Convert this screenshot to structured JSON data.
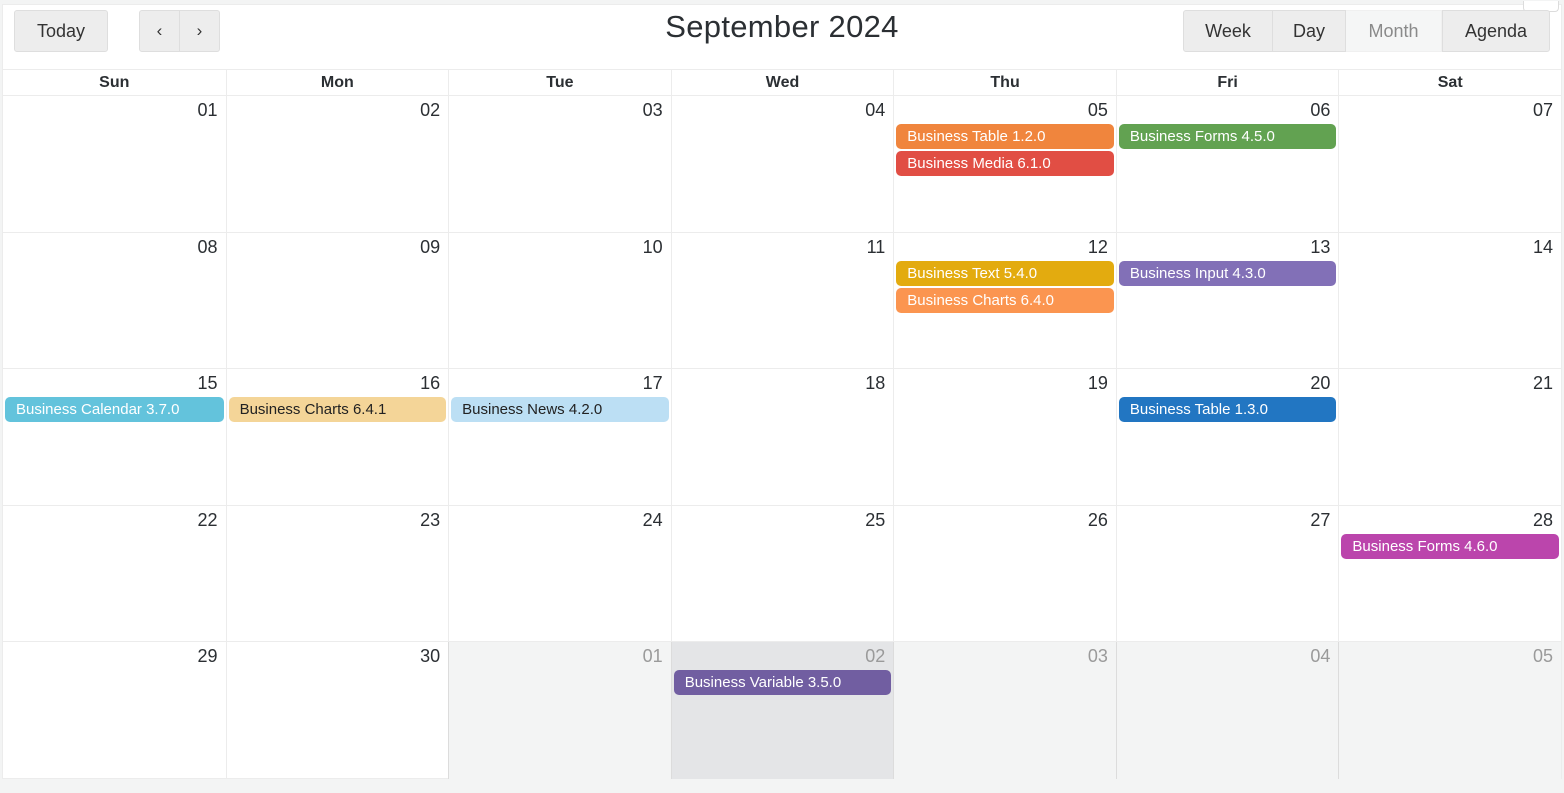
{
  "toolbar": {
    "today_label": "Today",
    "prev_label": "‹",
    "next_label": "›",
    "title": "September 2024",
    "views": [
      {
        "label": "Week",
        "active": false
      },
      {
        "label": "Day",
        "active": false
      },
      {
        "label": "Month",
        "active": true
      },
      {
        "label": "Agenda",
        "active": false
      }
    ]
  },
  "weekdays": [
    "Sun",
    "Mon",
    "Tue",
    "Wed",
    "Thu",
    "Fri",
    "Sat"
  ],
  "weeks": [
    [
      {
        "date": "01",
        "off": false,
        "events": []
      },
      {
        "date": "02",
        "off": false,
        "events": []
      },
      {
        "date": "03",
        "off": false,
        "events": []
      },
      {
        "date": "04",
        "off": false,
        "events": []
      },
      {
        "date": "05",
        "off": false,
        "events": [
          {
            "title": "Business Table 1.2.0",
            "color": "#f0853d",
            "text_dark": false
          },
          {
            "title": "Business Media 6.1.0",
            "color": "#e14e44",
            "text_dark": false
          }
        ]
      },
      {
        "date": "06",
        "off": false,
        "events": [
          {
            "title": "Business Forms 4.5.0",
            "color": "#62a251",
            "text_dark": false
          }
        ]
      },
      {
        "date": "07",
        "off": false,
        "events": []
      }
    ],
    [
      {
        "date": "08",
        "off": false,
        "events": []
      },
      {
        "date": "09",
        "off": false,
        "events": []
      },
      {
        "date": "10",
        "off": false,
        "events": []
      },
      {
        "date": "11",
        "off": false,
        "events": []
      },
      {
        "date": "12",
        "off": false,
        "events": [
          {
            "title": "Business Text 5.4.0",
            "color": "#e3ab0f",
            "text_dark": false
          },
          {
            "title": "Business Charts 6.4.0",
            "color": "#fb9550",
            "text_dark": false
          }
        ]
      },
      {
        "date": "13",
        "off": false,
        "events": [
          {
            "title": "Business Input 4.3.0",
            "color": "#8270b7",
            "text_dark": false
          }
        ]
      },
      {
        "date": "14",
        "off": false,
        "events": []
      }
    ],
    [
      {
        "date": "15",
        "off": false,
        "events": [
          {
            "title": "Business Calendar 3.7.0",
            "color": "#63c3dc",
            "text_dark": false
          }
        ]
      },
      {
        "date": "16",
        "off": false,
        "events": [
          {
            "title": "Business Charts 6.4.1",
            "color": "#f4d598",
            "text_dark": true
          }
        ]
      },
      {
        "date": "17",
        "off": false,
        "events": [
          {
            "title": "Business News 4.2.0",
            "color": "#bcdff4",
            "text_dark": true
          }
        ]
      },
      {
        "date": "18",
        "off": false,
        "events": []
      },
      {
        "date": "19",
        "off": false,
        "events": []
      },
      {
        "date": "20",
        "off": false,
        "events": [
          {
            "title": "Business Table 1.3.0",
            "color": "#2276c2",
            "text_dark": false
          }
        ]
      },
      {
        "date": "21",
        "off": false,
        "events": []
      }
    ],
    [
      {
        "date": "22",
        "off": false,
        "events": []
      },
      {
        "date": "23",
        "off": false,
        "events": []
      },
      {
        "date": "24",
        "off": false,
        "events": []
      },
      {
        "date": "25",
        "off": false,
        "events": []
      },
      {
        "date": "26",
        "off": false,
        "events": []
      },
      {
        "date": "27",
        "off": false,
        "events": []
      },
      {
        "date": "28",
        "off": false,
        "events": [
          {
            "title": "Business Forms 4.6.0",
            "color": "#bb45ac",
            "text_dark": false
          }
        ]
      }
    ],
    [
      {
        "date": "29",
        "off": false,
        "events": []
      },
      {
        "date": "30",
        "off": false,
        "events": []
      },
      {
        "date": "01",
        "off": true,
        "events": []
      },
      {
        "date": "02",
        "off": true,
        "highlight": true,
        "events": [
          {
            "title": "Business Variable 3.5.0",
            "color": "#715ea1",
            "text_dark": false
          }
        ]
      },
      {
        "date": "03",
        "off": true,
        "events": []
      },
      {
        "date": "04",
        "off": true,
        "events": []
      },
      {
        "date": "05",
        "off": true,
        "events": []
      }
    ]
  ]
}
